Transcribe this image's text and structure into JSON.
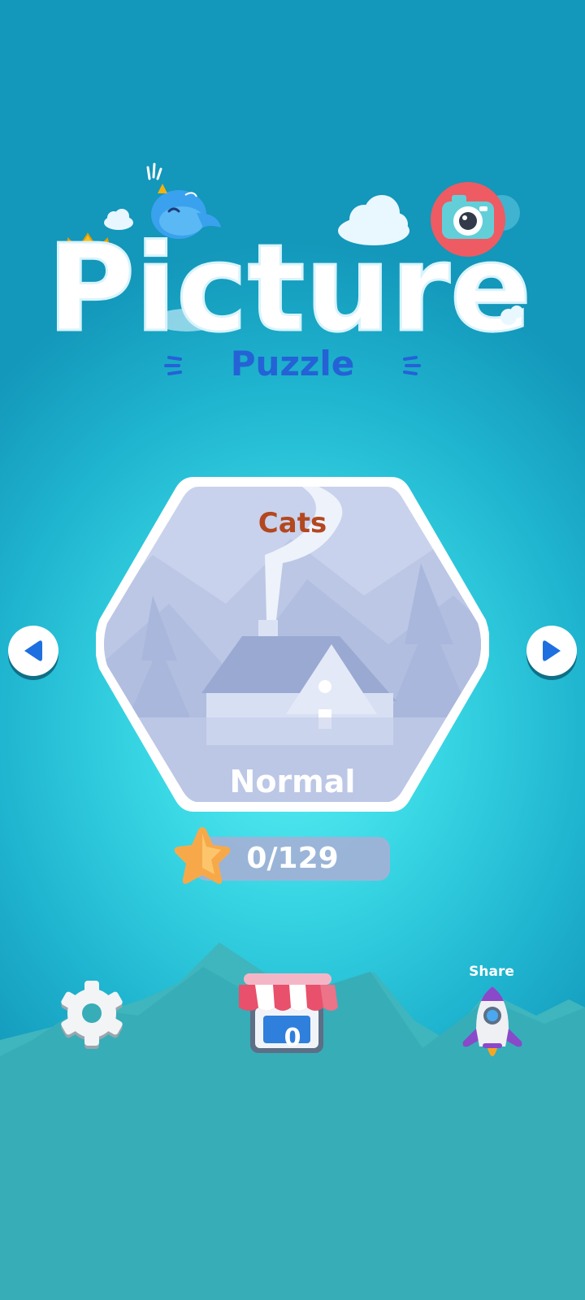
{
  "title": {
    "main": "Picture",
    "sub": "Puzzle"
  },
  "level": {
    "category": "Cats",
    "difficulty": "Normal",
    "progress": "0/129"
  },
  "toolbar": {
    "shop_count": "0",
    "share_label": "Share"
  },
  "icons": {
    "prev": "triangle-left-icon",
    "next": "triangle-right-icon",
    "star": "star-icon",
    "settings": "gear-icon",
    "shop": "shop-awning-icon",
    "share": "rocket-icon",
    "bird": "bird-icon",
    "camera": "camera-icon",
    "crown": "crown-icon"
  },
  "colors": {
    "background": "#2cc6dc",
    "category_text": "#b3471f",
    "title_white": "#ffffff",
    "puzzle_blue": "#2462d6",
    "arrow_blue": "#1e6fe0",
    "shop_red": "#e8506b",
    "rocket_purple": "#8a49c9"
  }
}
